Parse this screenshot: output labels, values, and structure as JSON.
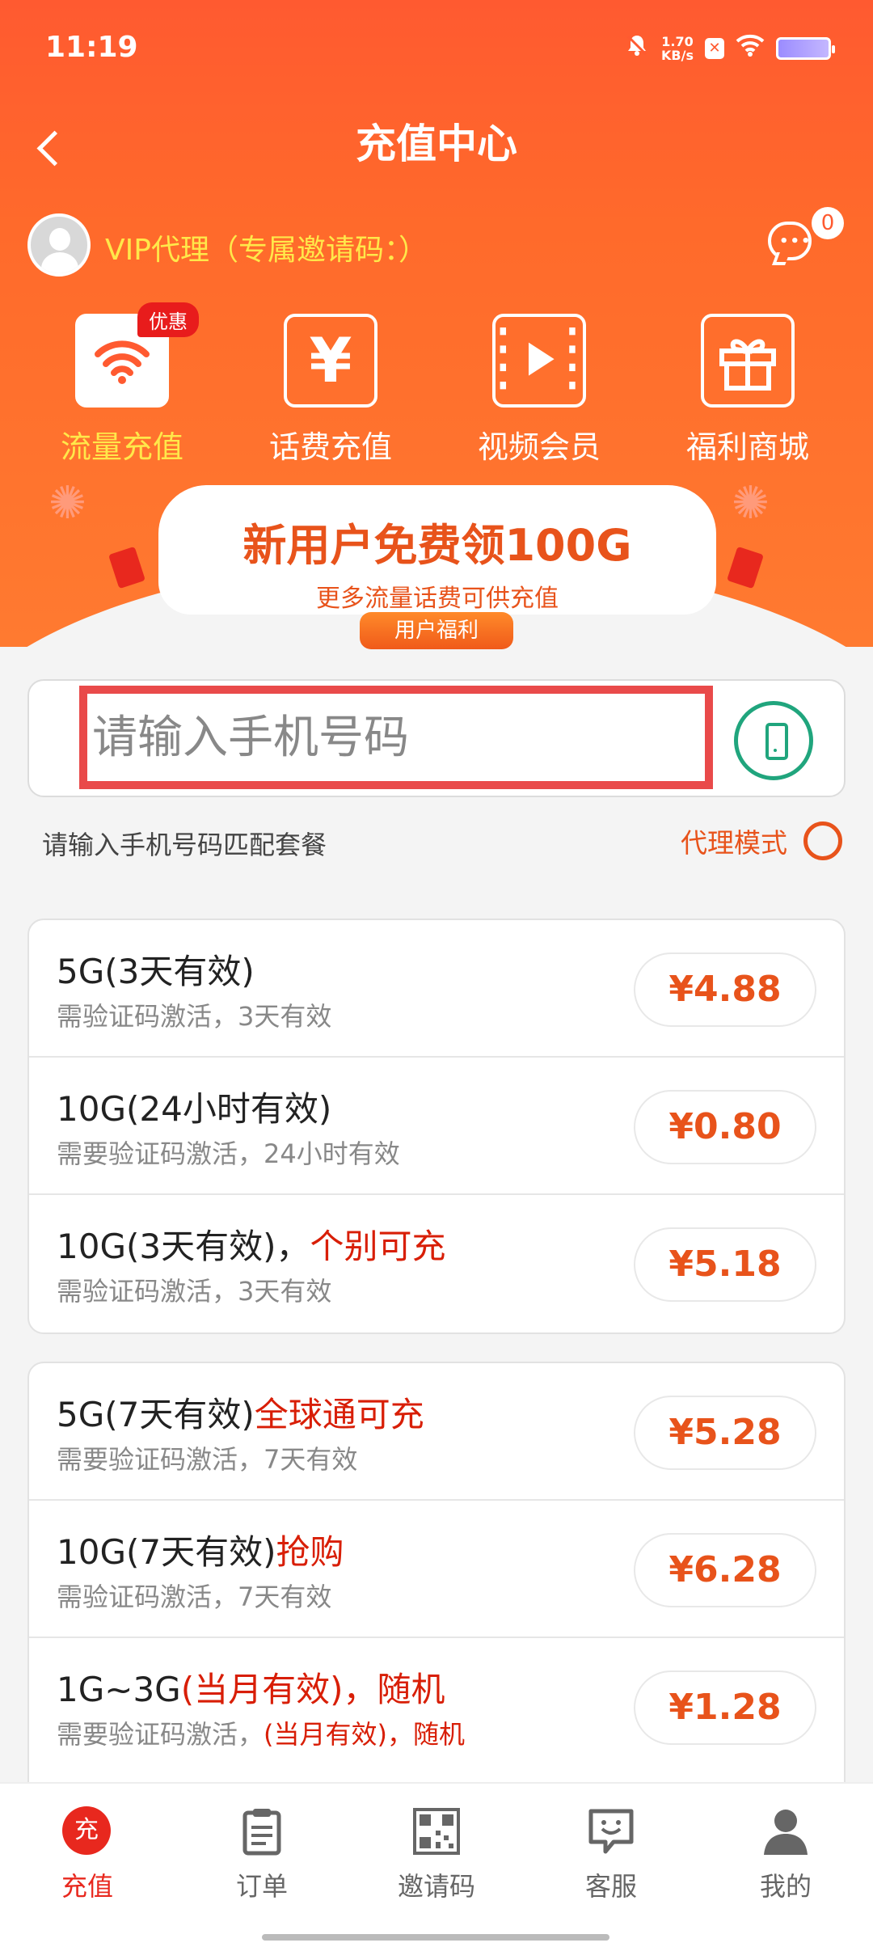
{
  "status_bar": {
    "time": "11:19",
    "speed_value": "1.70",
    "speed_unit": "KB/s"
  },
  "nav": {
    "title": "充值中心"
  },
  "vip": {
    "text": "VIP代理（专属邀请码：）",
    "message_count": "0"
  },
  "categories": [
    {
      "label": "流量充值",
      "icon": "wifi-icon",
      "badge": "优惠",
      "active": true
    },
    {
      "label": "话费充值",
      "icon": "yen-icon",
      "active": false
    },
    {
      "label": "视频会员",
      "icon": "video-play-icon",
      "active": false
    },
    {
      "label": "福利商城",
      "icon": "gift-icon",
      "active": false
    }
  ],
  "promo": {
    "title": "新用户免费领100G",
    "subtitle": "更多流量话费可供充值",
    "tag": "用户福利"
  },
  "phone": {
    "placeholder": "请输入手机号码"
  },
  "hint": {
    "text": "请输入手机号码匹配套餐",
    "agent_mode_label": "代理模式"
  },
  "plan_groups": [
    [
      {
        "title": "5G(3天有效)",
        "title_hl": "",
        "sub": "需验证码激活，3天有效",
        "sub_hl": "",
        "price": "¥4.88"
      },
      {
        "title": "10G(24小时有效)",
        "title_hl": "",
        "sub": "需要验证码激活，24小时有效",
        "sub_hl": "",
        "price": "¥0.80"
      },
      {
        "title": "10G(3天有效)，",
        "title_hl": "个别可充",
        "sub": "需验证码激活，3天有效",
        "sub_hl": "",
        "price": "¥5.18"
      }
    ],
    [
      {
        "title": "5G(7天有效)",
        "title_hl": "全球通可充",
        "sub": "需要验证码激活，7天有效",
        "sub_hl": "",
        "price": "¥5.28"
      },
      {
        "title": "10G(7天有效)",
        "title_hl": "抢购",
        "sub": "需验证码激活，7天有效",
        "sub_hl": "",
        "price": "¥6.28"
      },
      {
        "title": "1G~3G",
        "title_hl": "(当月有效)，随机",
        "sub": "需要验证码激活，",
        "sub_hl": "(当月有效)，随机",
        "price": "¥1.28"
      },
      {
        "title": "",
        "title_hl": "",
        "sub": "",
        "sub_hl": "",
        "price": ""
      }
    ]
  ],
  "tabs": [
    {
      "label": "充值",
      "icon": "recharge-icon",
      "active": true,
      "icon_char": "充"
    },
    {
      "label": "订单",
      "icon": "clipboard-icon",
      "active": false
    },
    {
      "label": "邀请码",
      "icon": "qrcode-icon",
      "active": false
    },
    {
      "label": "客服",
      "icon": "chat-smile-icon",
      "active": false
    },
    {
      "label": "我的",
      "icon": "user-icon",
      "active": false
    }
  ],
  "colors": {
    "brand": "#ff5a30",
    "price": "#e8531b",
    "highlight": "#d81e06",
    "vip": "#ffe84a",
    "phone_btn": "#20a57d"
  }
}
